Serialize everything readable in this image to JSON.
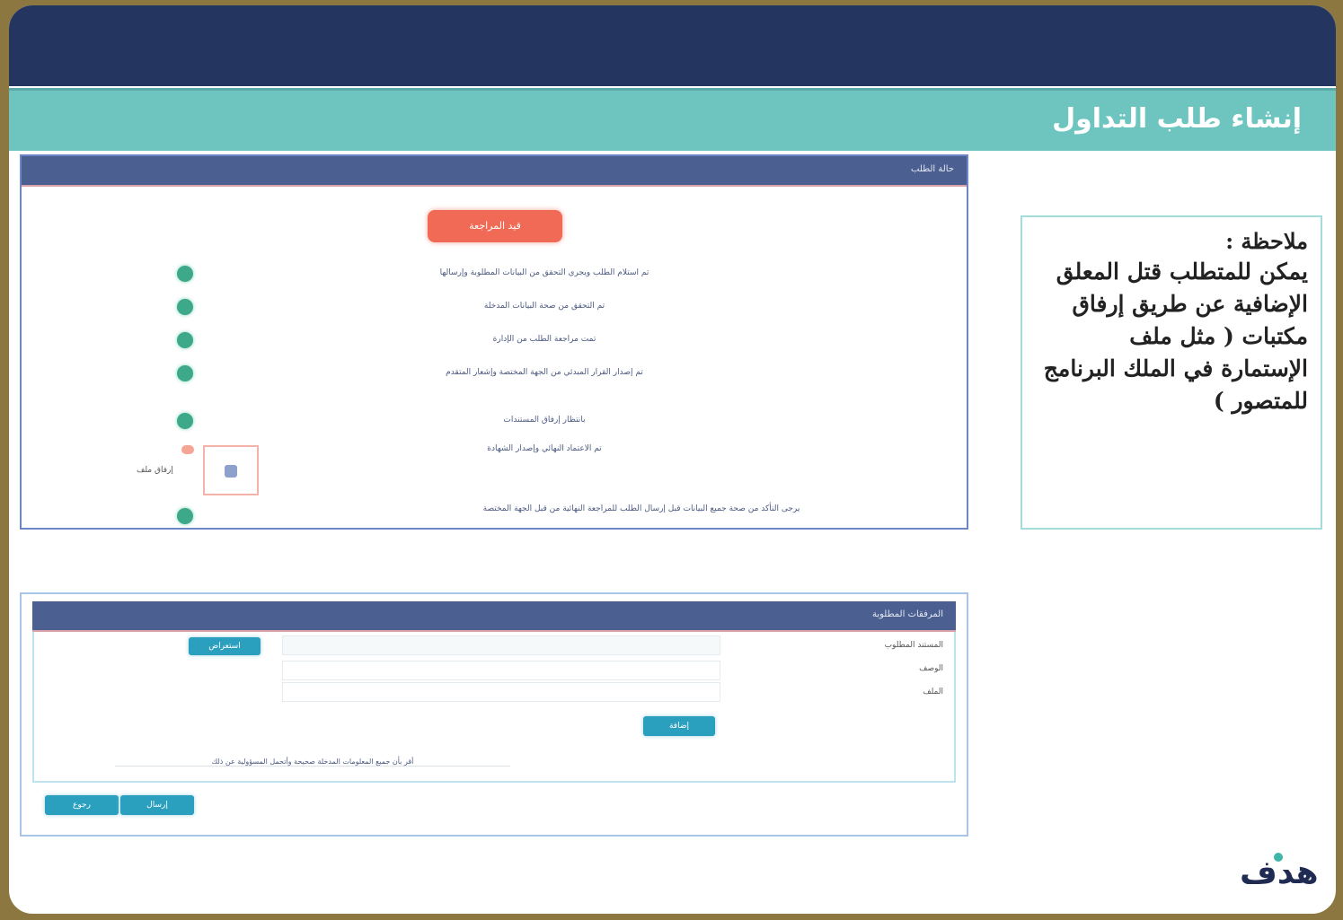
{
  "slide": {
    "title": "إنشاء طلب التداول"
  },
  "note": {
    "title": "ملاحظة :",
    "text": "يمكن للمتطلب قتل المعلق الإضافية عن طريق إرفاق مكتبات ( مثل ملف الإستمارة في الملك البرنامج للمتصور )"
  },
  "steps_panel": {
    "header": "حالة الطلب",
    "status_badge": "قيد المراجعة",
    "steps": [
      "تم استلام الطلب ويجري التحقق من البيانات المطلوبة وإرسالها",
      "تم التحقق من صحة البيانات المدخلة",
      "تمت مراجعة الطلب من الإدارة",
      "تم إصدار القرار المبدئي من الجهة المختصة وإشعار المتقدم",
      "بانتظار إرفاق المستندات",
      "تم الاعتماد النهائي وإصدار الشهادة"
    ],
    "upload_label": "إرفاق ملف",
    "bottom_note": "يرجى التأكد من صحة جميع البيانات قبل إرسال الطلب للمراجعة النهائية من قبل الجهة المختصة"
  },
  "form_panel": {
    "header": "المرفقات المطلوبة",
    "fields": [
      {
        "label": "المستند المطلوب",
        "placeholder": ""
      },
      {
        "label": "الوصف",
        "placeholder": ""
      },
      {
        "label": "الملف",
        "placeholder": ""
      }
    ],
    "browse_button": "استعراض",
    "add_button": "إضافة",
    "terms_text": "أقر بأن جميع المعلومات المدخلة صحيحة وأتحمل المسؤولية عن ذلك",
    "footer_buttons": [
      "رجوع",
      "إرسال"
    ]
  },
  "logo": {
    "text": "هدف"
  },
  "colors": {
    "header": "#243660",
    "title_band": "#6ec4bf",
    "panel_head": "#4b5f91",
    "status_badge": "#f06a55",
    "step_dot": "#3ea98a",
    "button": "#2b9fbe",
    "frame": "#8d7741"
  }
}
